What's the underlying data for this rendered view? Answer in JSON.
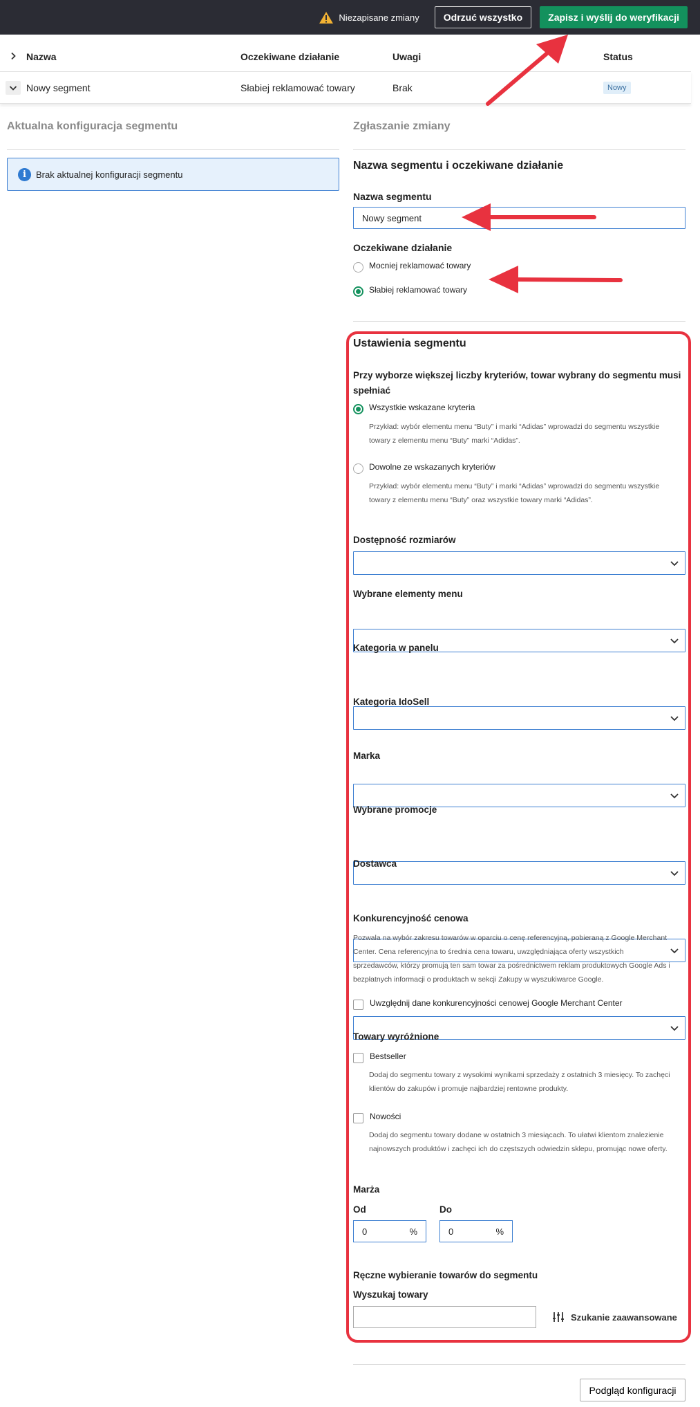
{
  "topbar": {
    "unsaved_label": "Niezapisane zmiany",
    "discard_label": "Odrzuć wszystko",
    "save_label": "Zapisz i wyślij do weryfikacji"
  },
  "table": {
    "headers": [
      "Nazwa",
      "Oczekiwane działanie",
      "Uwagi",
      "Status"
    ],
    "row": {
      "name": "Nowy segment",
      "action": "Słabiej reklamować towary",
      "notes": "Brak",
      "status": "Nowy"
    }
  },
  "left": {
    "title": "Aktualna konfiguracja segmentu",
    "info": "Brak aktualnej konfiguracji segmentu"
  },
  "right": {
    "title": "Zgłaszanie zmiany",
    "name_section_title": "Nazwa segmentu i oczekiwane działanie",
    "name_label": "Nazwa segmentu",
    "name_value": "Nowy segment",
    "action_label": "Oczekiwane działanie",
    "action_options": [
      "Mocniej reklamować towary",
      "Słabiej reklamować towary"
    ],
    "action_selected": 1
  },
  "settings": {
    "title": "Ustawienia segmentu",
    "criteria_label": "Przy wyborze większej liczby kryteriów, towar wybrany do segmentu musi spełniać",
    "criteria_all": "Wszystkie wskazane kryteria",
    "criteria_all_desc_1": "Przykład: wybór elementu menu “Buty” i marki “Adidas” wprowadzi do segmentu wszystkie",
    "criteria_all_desc_2": "towary z elementu menu “Buty” marki “Adidas”.",
    "criteria_any": "Dowolne ze wskazanych kryteriów",
    "criteria_any_desc_1": "Przykład: wybór elementu menu “Buty” i marki “Adidas” wprowadzi do segmentu wszystkie",
    "criteria_any_desc_2": "towary z elementu menu “Buty” oraz wszystkie towary marki “Adidas”.",
    "selects": [
      "Dostępność rozmiarów",
      "Wybrane elementy menu",
      "Kategoria w panelu",
      "Kategoria IdoSell",
      "Marka",
      "Wybrane promocje",
      "Dostawca"
    ],
    "price_title": "Konkurencyjność cenowa",
    "price_desc_1": "Pozwala na wybór zakresu towarów w oparciu o cenę referencyjną, pobieraną z Google Merchant",
    "price_desc_2": "Center. Cena referencyjna to średnia cena towaru, uwzględniająca oferty wszystkich",
    "price_desc_3": "sprzedawców, którzy promują ten sam towar za pośrednictwem reklam produktowych Google Ads i",
    "price_desc_4": "bezpłatnych informacji o produktach w sekcji Zakupy w wyszukiwarce Google.",
    "price_checkbox": "Uwzględnij dane konkurencyjności cenowej Google Merchant Center",
    "featured_title": "Towary wyróżnione",
    "bestseller": "Bestseller",
    "bestseller_desc_1": "Dodaj do segmentu towary z wysokimi wynikami sprzedaży z ostatnich 3 miesięcy. To zachęci",
    "bestseller_desc_2": "klientów do zakupów i promuje najbardziej rentowne produkty.",
    "news": "Nowości",
    "news_desc_1": "Dodaj do segmentu towary dodane w ostatnich 3 miesiącach. To ułatwi klientom znalezienie",
    "news_desc_2": "najnowszych produktów i zachęci ich do częstszych odwiedzin sklepu, promując nowe oferty.",
    "margin_title": "Marża",
    "from_label": "Od",
    "to_label": "Do",
    "from_value": "0",
    "to_value": "0",
    "pct": "%",
    "manual_title": "Ręczne wybieranie towarów do segmentu",
    "search_label": "Wyszukaj towary",
    "advanced_label": "Szukanie zaawansowane"
  },
  "footer": {
    "preview_label": "Podgląd konfiguracji"
  },
  "colors": {
    "accent": "#13915d",
    "topbar": "#2b2c34",
    "annotation": "#e8323f",
    "focus": "#3d7fd1"
  }
}
